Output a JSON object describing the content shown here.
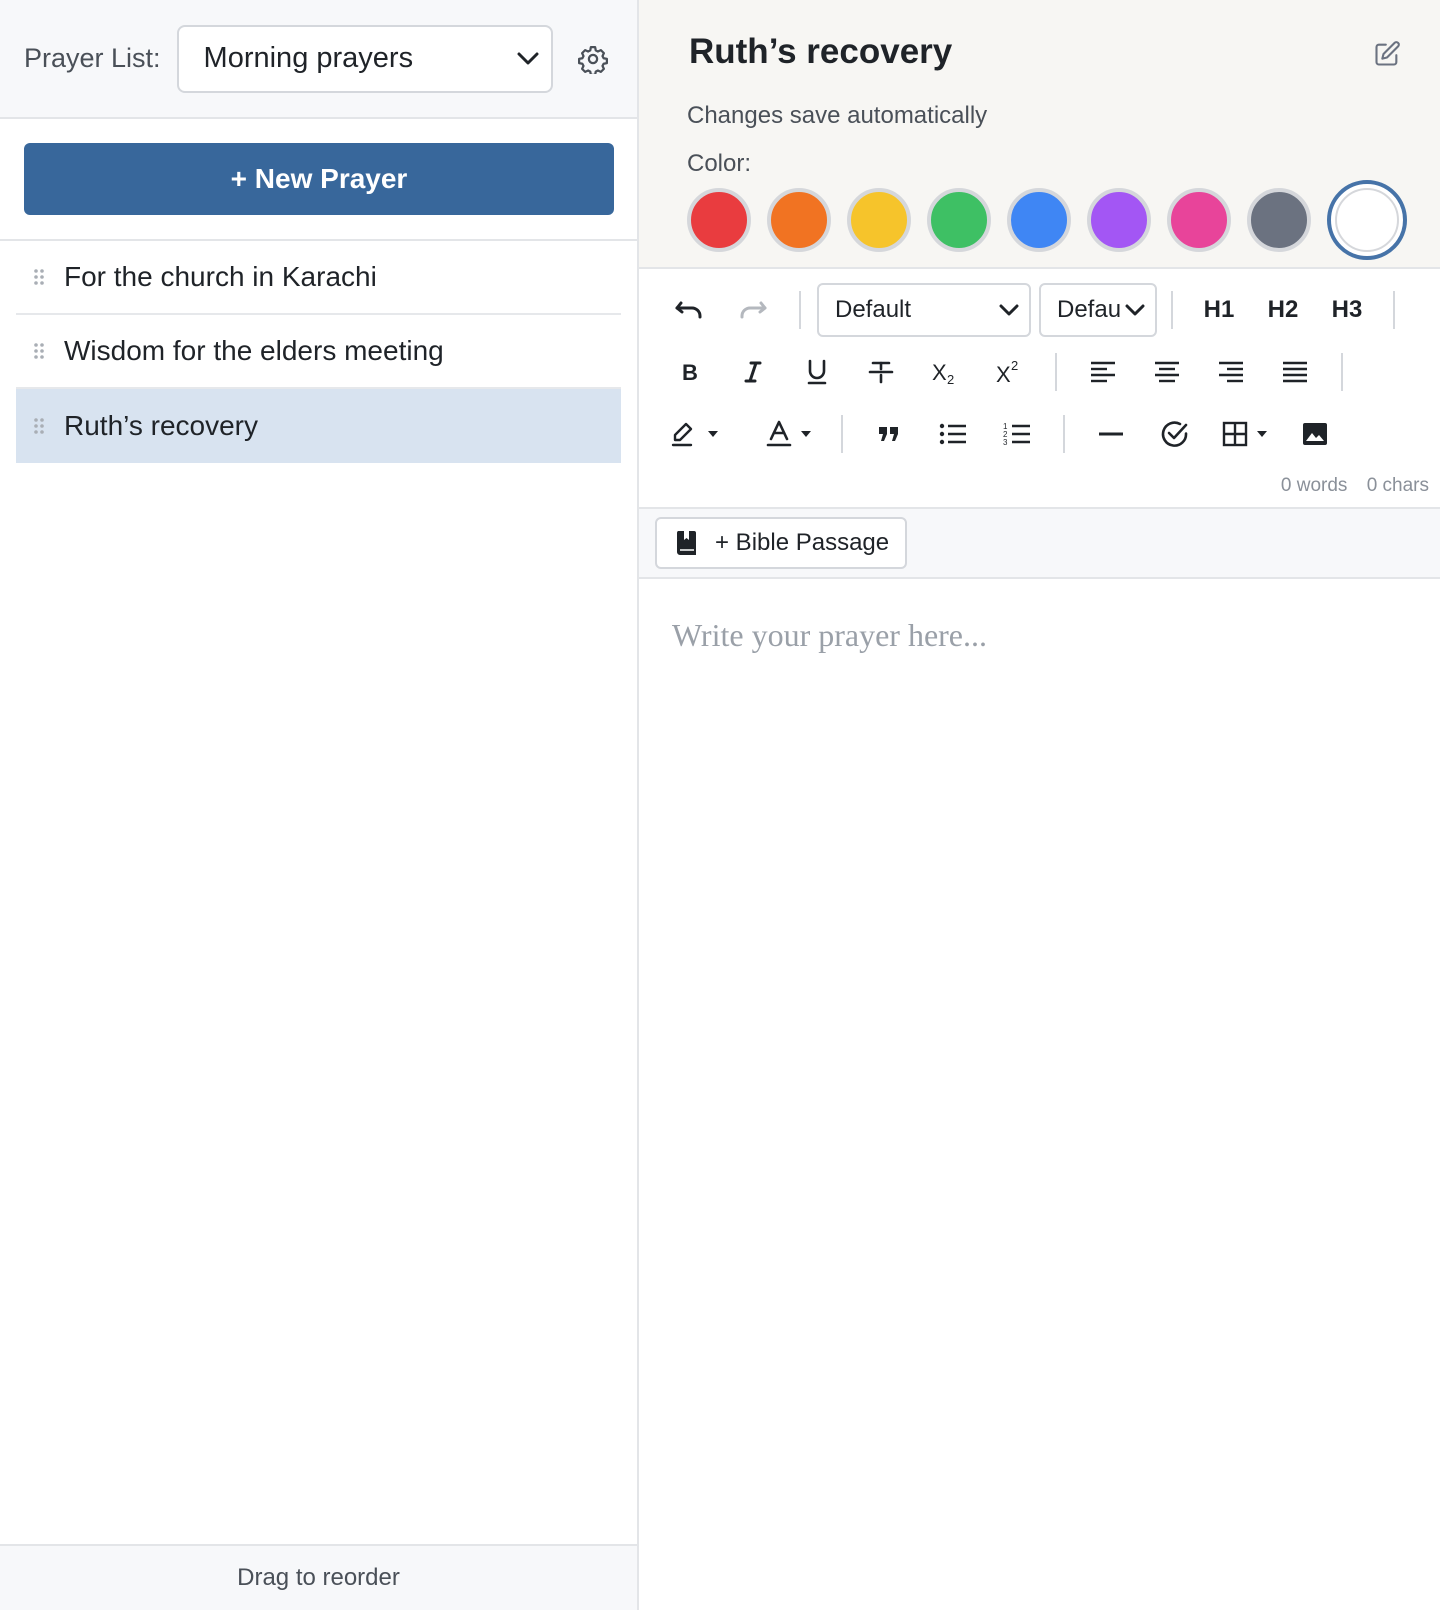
{
  "sidebar": {
    "list_label": "Prayer List:",
    "list_selected": "Morning prayers",
    "new_prayer_label": "+ New Prayer",
    "prayers": [
      {
        "title": "For the church in Karachi",
        "selected": false
      },
      {
        "title": "Wisdom for the elders meeting",
        "selected": false
      },
      {
        "title": "Ruth’s recovery",
        "selected": true
      }
    ],
    "footer_hint": "Drag to reorder"
  },
  "editor": {
    "title": "Ruth’s recovery",
    "autosave_note": "Changes save automatically",
    "color_label": "Color:",
    "colors": [
      "#e93c3f",
      "#f17322",
      "#f6c42b",
      "#3ec064",
      "#3f86f4",
      "#a356f4",
      "#e8449a",
      "#6b7280",
      "#ffffff"
    ],
    "selected_color_index": 8,
    "toolbar": {
      "font_family": "Default",
      "font_size": "Defau",
      "headings": [
        "H1",
        "H2",
        "H3"
      ],
      "word_count": "0 words",
      "char_count": "0 chars",
      "icons": [
        "undo-icon",
        "redo-icon",
        "bold-icon",
        "italic-icon",
        "underline-icon",
        "strikethrough-icon",
        "subscript-icon",
        "superscript-icon",
        "align-left-icon",
        "align-center-icon",
        "align-right-icon",
        "align-justify-icon",
        "highlight-icon",
        "text-color-icon",
        "blockquote-icon",
        "bullet-list-icon",
        "numbered-list-icon",
        "horizontal-rule-icon",
        "checklist-icon",
        "table-icon",
        "image-icon"
      ]
    },
    "bible_passage_label": "+ Bible Passage",
    "placeholder": "Write your prayer here..."
  }
}
